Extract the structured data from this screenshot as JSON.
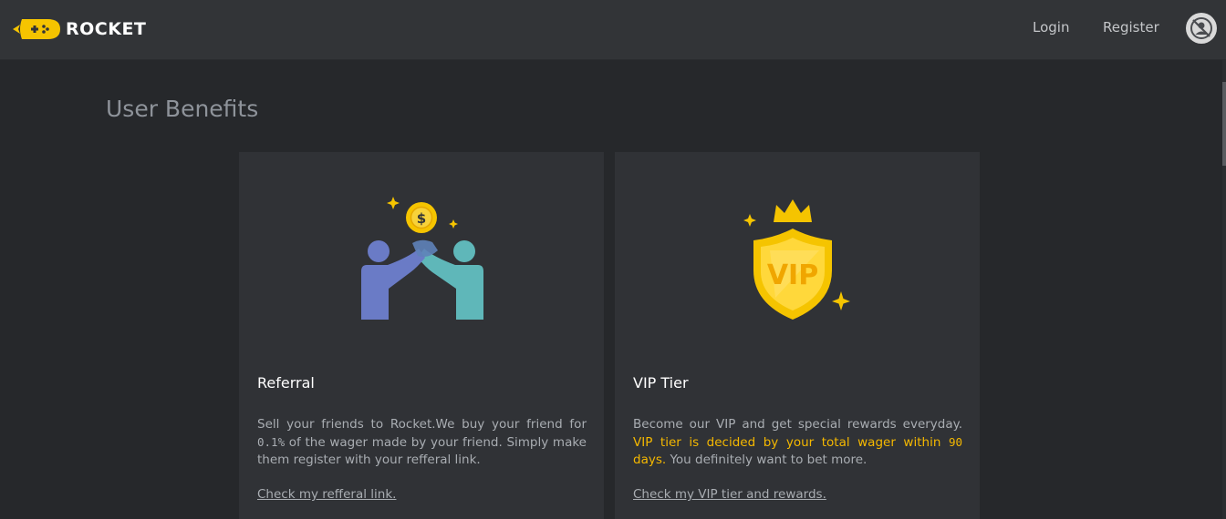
{
  "header": {
    "brand": "ROCKET",
    "nav": {
      "login": "Login",
      "register": "Register"
    },
    "avatar_icon": "no-avatar-icon"
  },
  "page": {
    "title": "User Benefits"
  },
  "cards": [
    {
      "title": "Referral",
      "illustration": "referral-high-five-icon",
      "desc_1": "Sell your friends to Rocket.We buy your friend for ",
      "desc_num": "0.1%",
      "desc_2": " of the wager made by your friend. Simply make them register with your refferal link.",
      "link": "Check my refferal link."
    },
    {
      "title": "VIP Tier",
      "illustration": "vip-shield-icon",
      "illustration_text": "VIP",
      "desc_1": "Become our VIP and get special rewards everyday. ",
      "desc_hl_1": "VIP tier is decided by your total wager within ",
      "desc_num": "90",
      "desc_hl_2": " days.",
      "desc_2": " You definitely want to bet more.",
      "link": "Check my VIP tier and rewards."
    }
  ],
  "colors": {
    "background": "#26282b",
    "topbar": "#323437",
    "card": "#303236",
    "accent_yellow": "#f5b800",
    "muted_text": "#a9adb2"
  }
}
